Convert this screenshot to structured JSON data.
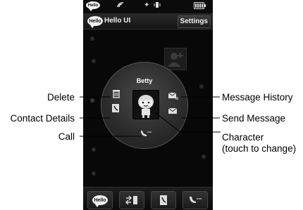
{
  "app": {
    "title": "Hello UI",
    "settings_label": "Settings",
    "hello_badge": "Hello"
  },
  "status_icons": [
    "signal-icon",
    "bluetooth-icon",
    "vibrate-icon",
    "battery-icon"
  ],
  "contact": {
    "name": "Betty"
  },
  "wheel_actions": [
    {
      "name": "delete",
      "icon": "trash-icon"
    },
    {
      "name": "contact-details",
      "icon": "address-book-icon"
    },
    {
      "name": "call",
      "icon": "phone-icon"
    },
    {
      "name": "message-history",
      "icon": "envelope-list-icon"
    },
    {
      "name": "send-message",
      "icon": "envelope-icon"
    },
    {
      "name": "character",
      "icon": "character-avatar-icon"
    }
  ],
  "dock": [
    {
      "icon": "hello-icon",
      "label": "Hello"
    },
    {
      "icon": "transfer-icon"
    },
    {
      "icon": "contacts-icon"
    },
    {
      "icon": "call-log-icon"
    }
  ],
  "callouts": {
    "delete": "Delete",
    "contact_details": "Contact Details",
    "call": "Call",
    "message_history": "Message History",
    "send_message": "Send Message",
    "character_line1": "Character",
    "character_line2": "(touch to change)"
  }
}
